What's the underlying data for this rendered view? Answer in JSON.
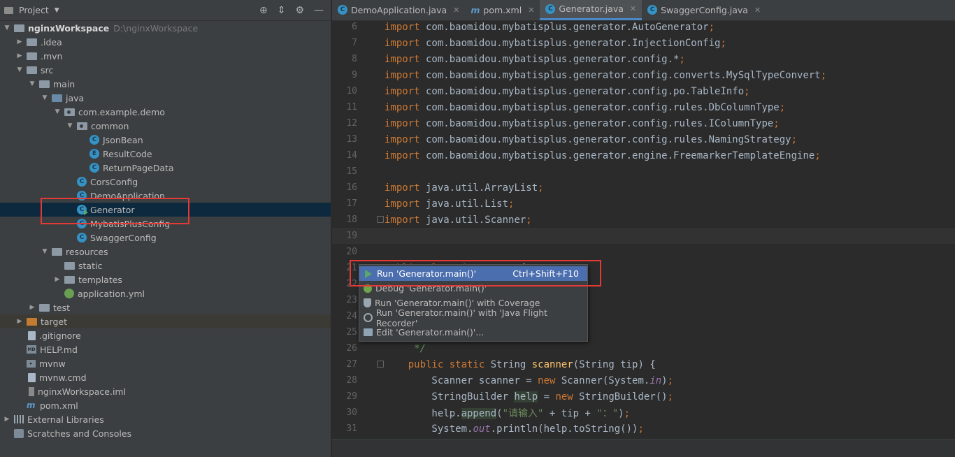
{
  "project": {
    "title": "Project",
    "tree": [
      {
        "label": "nginxWorkspace",
        "path": "D:\\nginxWorkspace",
        "depth": 0,
        "arrow": "down",
        "icon": "folder"
      },
      {
        "label": ".idea",
        "depth": 1,
        "arrow": "right",
        "icon": "folder"
      },
      {
        "label": ".mvn",
        "depth": 1,
        "arrow": "right",
        "icon": "folder"
      },
      {
        "label": "src",
        "depth": 1,
        "arrow": "down",
        "icon": "folder"
      },
      {
        "label": "main",
        "depth": 2,
        "arrow": "down",
        "icon": "folder"
      },
      {
        "label": "java",
        "depth": 3,
        "arrow": "down",
        "icon": "folder-blue"
      },
      {
        "label": "com.example.demo",
        "depth": 4,
        "arrow": "down",
        "icon": "package"
      },
      {
        "label": "common",
        "depth": 5,
        "arrow": "down",
        "icon": "package"
      },
      {
        "label": "JsonBean",
        "depth": 6,
        "arrow": "none",
        "icon": "class"
      },
      {
        "label": "ResultCode",
        "depth": 6,
        "arrow": "none",
        "icon": "enum"
      },
      {
        "label": "ReturnPageData",
        "depth": 6,
        "arrow": "none",
        "icon": "class"
      },
      {
        "label": "CorsConfig",
        "depth": 5,
        "arrow": "none",
        "icon": "class"
      },
      {
        "label": "DemoApplication",
        "depth": 5,
        "arrow": "none",
        "icon": "class"
      },
      {
        "label": "Generator",
        "depth": 5,
        "arrow": "none",
        "icon": "class-runnable",
        "selected": true
      },
      {
        "label": "MybatisPlusConfig",
        "depth": 5,
        "arrow": "none",
        "icon": "class"
      },
      {
        "label": "SwaggerConfig",
        "depth": 5,
        "arrow": "none",
        "icon": "class"
      },
      {
        "label": "resources",
        "depth": 3,
        "arrow": "down",
        "icon": "folder"
      },
      {
        "label": "static",
        "depth": 4,
        "arrow": "none",
        "icon": "folder"
      },
      {
        "label": "templates",
        "depth": 4,
        "arrow": "right",
        "icon": "folder"
      },
      {
        "label": "application.yml",
        "depth": 4,
        "arrow": "none",
        "icon": "yml"
      },
      {
        "label": "test",
        "depth": 2,
        "arrow": "right",
        "icon": "folder"
      },
      {
        "label": "target",
        "depth": 1,
        "arrow": "right",
        "icon": "folder-orange",
        "excluded": true
      },
      {
        "label": ".gitignore",
        "depth": 1,
        "arrow": "none",
        "icon": "file"
      },
      {
        "label": "HELP.md",
        "depth": 1,
        "arrow": "none",
        "icon": "md"
      },
      {
        "label": "mvnw",
        "depth": 1,
        "arrow": "none",
        "icon": "terminal"
      },
      {
        "label": "mvnw.cmd",
        "depth": 1,
        "arrow": "none",
        "icon": "file"
      },
      {
        "label": "nginxWorkspace.iml",
        "depth": 1,
        "arrow": "none",
        "icon": "iml"
      },
      {
        "label": "pom.xml",
        "depth": 1,
        "arrow": "none",
        "icon": "maven"
      },
      {
        "label": "External Libraries",
        "depth": 0,
        "arrow": "right",
        "icon": "libraries"
      },
      {
        "label": "Scratches and Consoles",
        "depth": 0,
        "arrow": "none",
        "icon": "scratch"
      }
    ]
  },
  "tabs": [
    {
      "label": "DemoApplication.java",
      "icon": "class",
      "active": false
    },
    {
      "label": "pom.xml",
      "icon": "maven",
      "active": false
    },
    {
      "label": "Generator.java",
      "icon": "class",
      "active": true
    },
    {
      "label": "SwaggerConfig.java",
      "icon": "class",
      "active": false
    }
  ],
  "code_lines": [
    {
      "n": "6",
      "tokens": [
        [
          "kw",
          "import"
        ],
        [
          "t",
          " com.baomidou.mybatisplus.generator.AutoGenerator"
        ],
        [
          "kw",
          ";"
        ]
      ]
    },
    {
      "n": "7",
      "tokens": [
        [
          "kw",
          "import"
        ],
        [
          "t",
          " com.baomidou.mybatisplus.generator.InjectionConfig"
        ],
        [
          "kw",
          ";"
        ]
      ]
    },
    {
      "n": "8",
      "tokens": [
        [
          "kw",
          "import"
        ],
        [
          "t",
          " com.baomidou.mybatisplus.generator.config.*"
        ],
        [
          "kw",
          ";"
        ]
      ]
    },
    {
      "n": "9",
      "tokens": [
        [
          "kw",
          "import"
        ],
        [
          "t",
          " com.baomidou.mybatisplus.generator.config.converts.MySqlTypeConvert"
        ],
        [
          "kw",
          ";"
        ]
      ]
    },
    {
      "n": "10",
      "tokens": [
        [
          "kw",
          "import"
        ],
        [
          "t",
          " com.baomidou.mybatisplus.generator.config.po.TableInfo"
        ],
        [
          "kw",
          ";"
        ]
      ]
    },
    {
      "n": "11",
      "tokens": [
        [
          "kw",
          "import"
        ],
        [
          "t",
          " com.baomidou.mybatisplus.generator.config.rules.DbColumnType"
        ],
        [
          "kw",
          ";"
        ]
      ]
    },
    {
      "n": "12",
      "tokens": [
        [
          "kw",
          "import"
        ],
        [
          "t",
          " com.baomidou.mybatisplus.generator.config.rules.IColumnType"
        ],
        [
          "kw",
          ";"
        ]
      ]
    },
    {
      "n": "13",
      "tokens": [
        [
          "kw",
          "import"
        ],
        [
          "t",
          " com.baomidou.mybatisplus.generator.config.rules.NamingStrategy"
        ],
        [
          "kw",
          ";"
        ]
      ]
    },
    {
      "n": "14",
      "tokens": [
        [
          "kw",
          "import"
        ],
        [
          "t",
          " com.baomidou.mybatisplus.generator.engine.FreemarkerTemplateEngine"
        ],
        [
          "kw",
          ";"
        ]
      ]
    },
    {
      "n": "15",
      "tokens": []
    },
    {
      "n": "16",
      "tokens": [
        [
          "kw",
          "import"
        ],
        [
          "t",
          " java.util.ArrayList"
        ],
        [
          "kw",
          ";"
        ]
      ]
    },
    {
      "n": "17",
      "tokens": [
        [
          "kw",
          "import"
        ],
        [
          "t",
          " java.util.List"
        ],
        [
          "kw",
          ";"
        ]
      ]
    },
    {
      "n": "18",
      "tokens": [
        [
          "kw",
          "import"
        ],
        [
          "t",
          " java.util.Scanner"
        ],
        [
          "kw",
          ";"
        ]
      ],
      "fold": true
    },
    {
      "n": "19",
      "tokens": [],
      "caret": true
    },
    {
      "n": "20",
      "tokens": []
    },
    {
      "n": "21",
      "tokens": [
        [
          "kw",
          "public class "
        ],
        [
          "t",
          "Generator {"
        ]
      ]
    },
    {
      "n": "22",
      "tokens": []
    },
    {
      "n": "23",
      "tokens": []
    },
    {
      "n": "24",
      "tokens": []
    },
    {
      "n": "25",
      "tokens": []
    },
    {
      "n": "26",
      "tokens": [
        [
          "cm",
          "     */"
        ]
      ]
    },
    {
      "n": "27",
      "tokens": [
        [
          "t",
          "    "
        ],
        [
          "kw",
          "public static "
        ],
        [
          "t",
          "String "
        ],
        [
          "fn",
          "scanner"
        ],
        [
          "t",
          "(String tip) {"
        ]
      ],
      "fold": true
    },
    {
      "n": "28",
      "tokens": [
        [
          "t",
          "        Scanner scanner = "
        ],
        [
          "kw",
          "new "
        ],
        [
          "t",
          "Scanner(System."
        ],
        [
          "st",
          "in"
        ],
        [
          "t",
          ")"
        ],
        [
          "kw",
          ";"
        ]
      ]
    },
    {
      "n": "29",
      "tokens": [
        [
          "t",
          "        StringBuilder "
        ],
        [
          "hl",
          "help"
        ],
        [
          "t",
          " = "
        ],
        [
          "kw",
          "new "
        ],
        [
          "t",
          "StringBuilder()"
        ],
        [
          "kw",
          ";"
        ]
      ]
    },
    {
      "n": "30",
      "tokens": [
        [
          "t",
          "        help."
        ],
        [
          "hl",
          "append"
        ],
        [
          "t",
          "("
        ],
        [
          "str",
          "\"请输入\""
        ],
        [
          "t",
          " + tip + "
        ],
        [
          "str",
          "\"：\""
        ],
        [
          "t",
          ")"
        ],
        [
          "kw",
          ";"
        ]
      ]
    },
    {
      "n": "31",
      "tokens": [
        [
          "t",
          "        System."
        ],
        [
          "st",
          "out"
        ],
        [
          "t",
          ".println(help.toString())"
        ],
        [
          "kw",
          ";"
        ]
      ]
    }
  ],
  "context_menu": {
    "items": [
      {
        "label": "Run 'Generator.main()'",
        "shortcut": "Ctrl+Shift+F10",
        "icon": "run-icon",
        "active": true
      },
      {
        "label": "Debug 'Generator.main()'",
        "shortcut": "",
        "icon": "debug-icon",
        "active": false
      },
      {
        "label": "Run 'Generator.main()' with Coverage",
        "shortcut": "",
        "icon": "coverage-icon",
        "active": false
      },
      {
        "label": "Run 'Generator.main()' with 'Java Flight Recorder'",
        "shortcut": "",
        "icon": "flight-recorder-icon",
        "active": false
      },
      {
        "label": "Edit 'Generator.main()'...",
        "shortcut": "",
        "icon": "edit-config-icon",
        "active": false
      }
    ]
  },
  "colors": {
    "accent": "#4b6eaf",
    "selection": "#0d293e",
    "annotation": "#e53935",
    "run_green": "#59a869"
  }
}
